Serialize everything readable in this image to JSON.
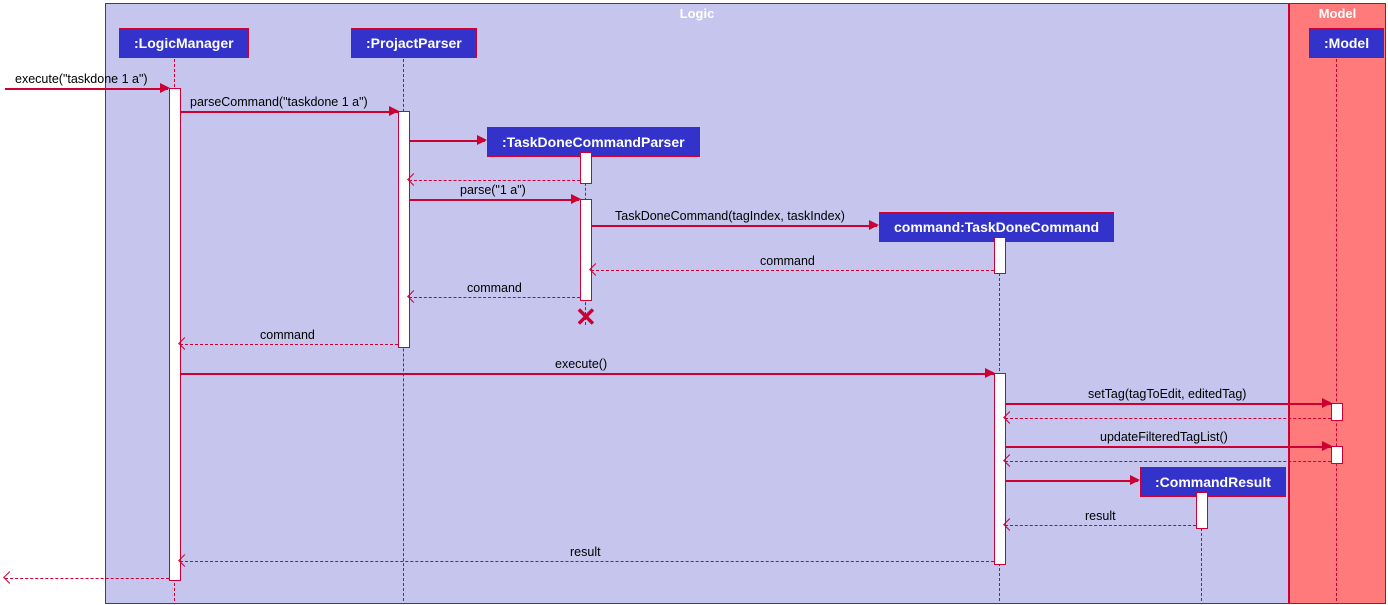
{
  "regions": {
    "logic": "Logic",
    "model": "Model"
  },
  "participants": {
    "logicManager": ":LogicManager",
    "projactParser": ":ProjactParser",
    "taskDoneCommandParser": ":TaskDoneCommandParser",
    "taskDoneCommand": "command:TaskDoneCommand",
    "commandResult": ":CommandResult",
    "model": ":Model"
  },
  "messages": {
    "execute_entry": "execute(\"taskdone 1 a\")",
    "parseCommand": "parseCommand(\"taskdone 1 a\")",
    "parse": "parse(\"1 a\")",
    "taskDoneCommand": "TaskDoneCommand(tagIndex, taskIndex)",
    "command1": "command",
    "command2": "command",
    "command3": "command",
    "executeCall": "execute()",
    "setTag": "setTag(tagToEdit, editedTag)",
    "updateFilteredTagList": "updateFilteredTagList()",
    "result1": "result",
    "result2": "result"
  }
}
